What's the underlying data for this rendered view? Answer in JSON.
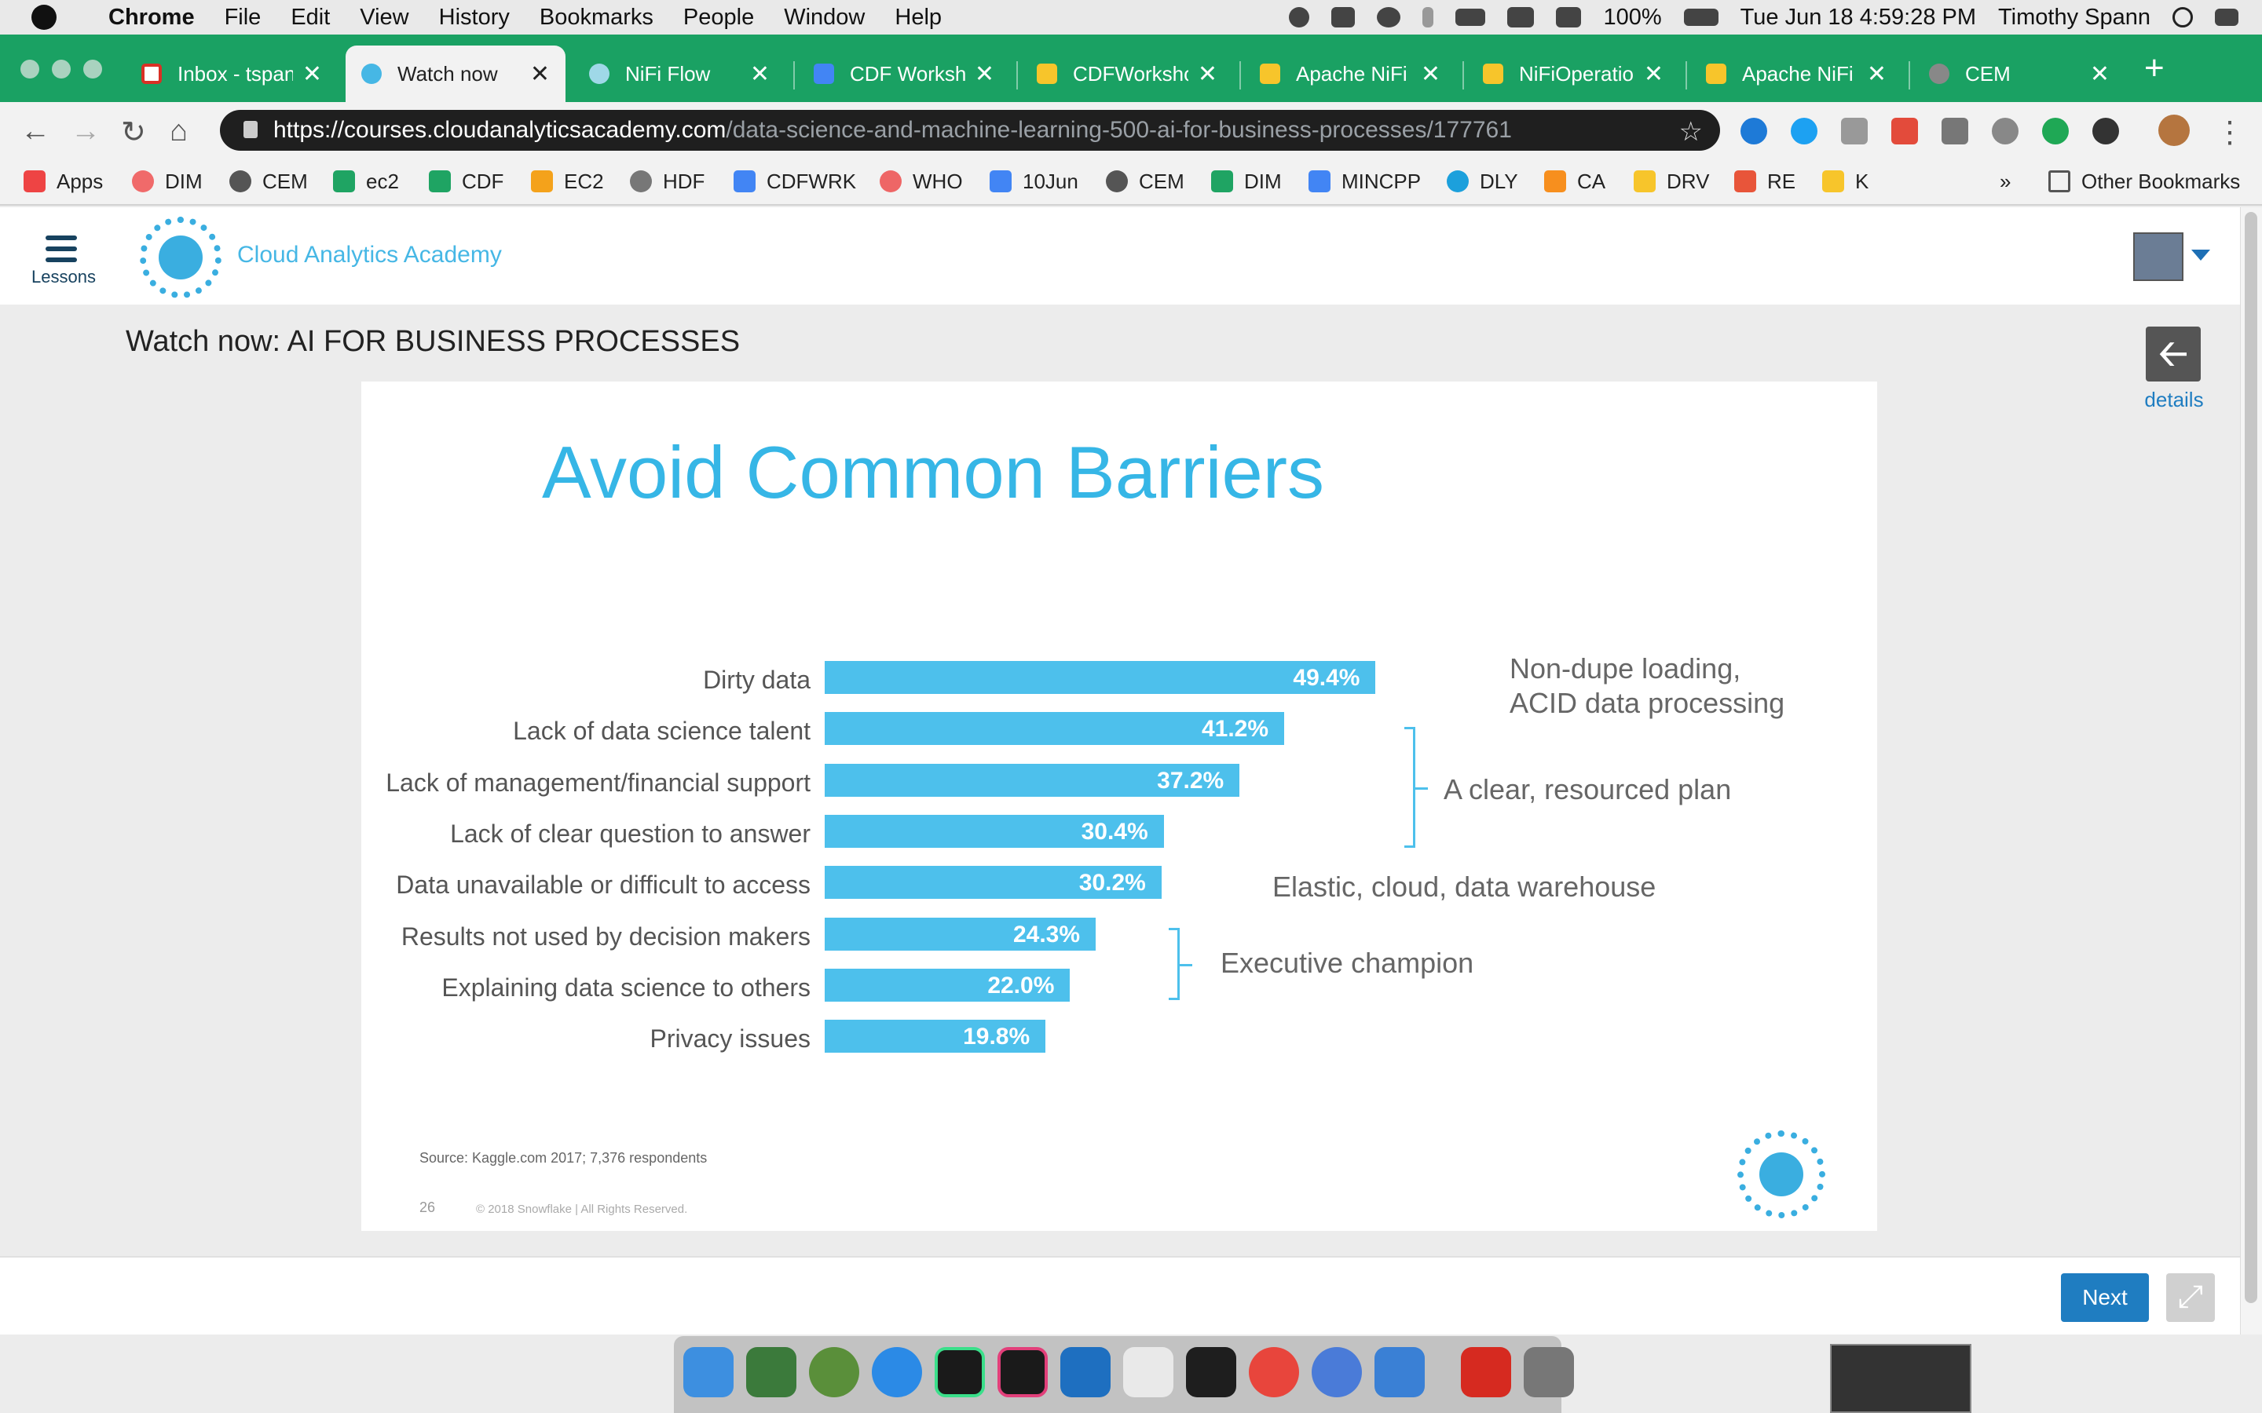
{
  "menubar": {
    "app": "Chrome",
    "items": [
      "File",
      "Edit",
      "View",
      "History",
      "Bookmarks",
      "People",
      "Window",
      "Help"
    ],
    "battery": "100%",
    "datetime": "Tue Jun 18  4:59:28 PM",
    "user": "Timothy Spann"
  },
  "tabs": [
    {
      "label": "Inbox - tspann",
      "icon": "gmail-icon"
    },
    {
      "label": "Watch now",
      "icon": "course-icon"
    },
    {
      "label": "NiFi Flow",
      "icon": "nifi-icon"
    },
    {
      "label": "CDF Worksho",
      "icon": "docs-icon"
    },
    {
      "label": "CDFWorkshop",
      "icon": "slides-icon"
    },
    {
      "label": "Apache NiFi P",
      "icon": "slides-icon"
    },
    {
      "label": "NiFiOperation",
      "icon": "slides-icon"
    },
    {
      "label": "Apache NiFi C",
      "icon": "slides-icon"
    },
    {
      "label": "CEM",
      "icon": "globe-icon"
    }
  ],
  "address": {
    "prefix": "https://",
    "host": "courses.cloudanalyticsacademy.com",
    "path": "/data-science-and-machine-learning-500-ai-for-business-processes/177761"
  },
  "bookmarks": [
    "Apps",
    "DIM",
    "CEM",
    "ec2",
    "CDF",
    "EC2",
    "HDF",
    "CDFWRK",
    "WHO",
    "10Jun",
    "CEM",
    "DIM",
    "MINCPP",
    "DLY",
    "CA",
    "DRV",
    "RE",
    "K"
  ],
  "bookmarks_more": "»",
  "other_bookmarks": "Other Bookmarks",
  "header": {
    "lessons": "Lessons",
    "brand": "Cloud Analytics Academy"
  },
  "content": {
    "watch_title": "Watch now: AI FOR BUSINESS PROCESSES",
    "details": "details",
    "back_glyph": "🡠"
  },
  "slide": {
    "title": "Avoid Common Barriers",
    "notes": {
      "n1a": "Non-dupe loading,",
      "n1b": "ACID data processing",
      "n2": "A clear, resourced plan",
      "n3": "Elastic, cloud, data warehouse",
      "n4": "Executive  champion"
    },
    "source": "Source: Kaggle.com 2017; 7,376 respondents",
    "page": "26",
    "copyright": "© 2018 Snowflake  |  All Rights Reserved."
  },
  "chart_data": {
    "type": "bar",
    "orientation": "horizontal",
    "title": "Avoid Common Barriers",
    "categories": [
      "Dirty data",
      "Lack of data science talent",
      "Lack of management/financial support",
      "Lack of clear question to answer",
      "Data unavailable or difficult to access",
      "Results not used by decision makers",
      "Explaining data science to others",
      "Privacy issues"
    ],
    "values": [
      49.4,
      41.2,
      37.2,
      30.4,
      30.2,
      24.3,
      22.0,
      19.8
    ],
    "labels": [
      "49.4%",
      "41.2%",
      "37.2%",
      "30.4%",
      "30.2%",
      "24.3%",
      "22.0%",
      "19.8%"
    ],
    "unit": "%",
    "color": "#4dc0ec"
  },
  "footer": {
    "next": "Next",
    "fullscreen_glyph": "⤢"
  },
  "colors": {
    "accent": "#36b6e6",
    "button": "#1f7dc1",
    "tabstrip": "#1aa163"
  }
}
